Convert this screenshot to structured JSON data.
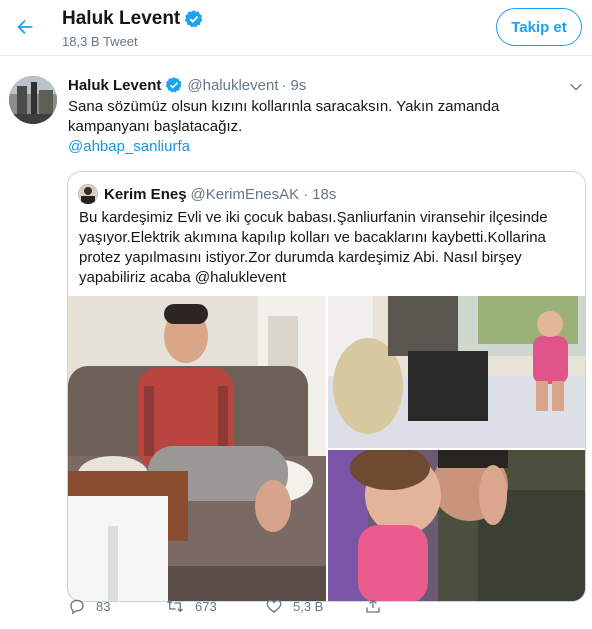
{
  "header": {
    "back_icon": "arrow-left-icon",
    "name": "Haluk Levent",
    "tweet_count": "18,3 B Tweet",
    "follow_label": "Takip et"
  },
  "tweet": {
    "author_name": "Haluk Levent",
    "author_handle": "@haluklevent",
    "dot": "·",
    "time": "9s",
    "text": "Sana sözümüz olsun kızını kollarınla saracaksın. Yakın zamanda kampanyanı başlatacağız.",
    "mention": "@ahbap_sanliurfa",
    "quote": {
      "author_name": "Kerim Eneş",
      "author_handle": "@KerimEnesAK",
      "dot": "·",
      "time": "18s",
      "text": "Bu kardeşimiz Evli ve iki çocuk babası.Şanliurfanin viransehir ilçesinde yaşıyor.Elektrik akımına kapılıp kolları ve bacaklarını kaybetti.Kollarina protez yapılmasını istiyor.Zor durumda kardeşimiz Abi. Nasıl birşey yapabiliriz acaba @haluklevent"
    },
    "actions": {
      "reply_count": "83",
      "retweet_count": "673",
      "like_count": "5,3 B"
    }
  },
  "colors": {
    "accent": "#1da1f2",
    "link": "#1b95e0",
    "secondary_text": "#657786",
    "border": "#e6ecf0"
  }
}
